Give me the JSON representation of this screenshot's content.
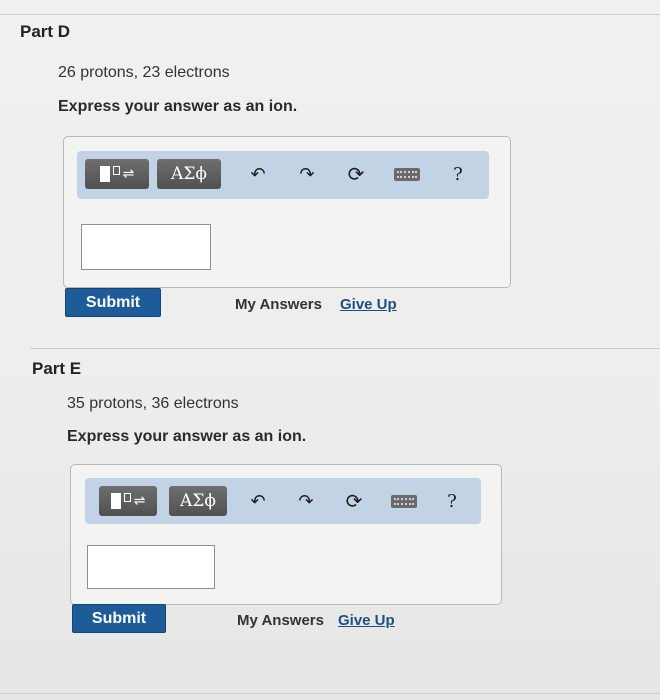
{
  "parts": [
    {
      "title": "Part D",
      "question": "26 protons, 23 electrons",
      "prompt": "Express your answer as an ion.",
      "toolbar": {
        "symbols_label": "ΑΣϕ",
        "help_label": "?"
      },
      "answer_value": "",
      "submit_label": "Submit",
      "my_answers_label": "My Answers",
      "give_up_label": "Give Up"
    },
    {
      "title": "Part E",
      "question": "35 protons, 36 electrons",
      "prompt": "Express your answer as an ion.",
      "toolbar": {
        "symbols_label": "ΑΣϕ",
        "help_label": "?"
      },
      "answer_value": "",
      "submit_label": "Submit",
      "my_answers_label": "My Answers",
      "give_up_label": "Give Up"
    }
  ],
  "icons": [
    "matrix-template-icon",
    "undo-icon",
    "redo-icon",
    "reset-icon",
    "keyboard-icon"
  ],
  "colors": {
    "submit_bg": "#1d5c99",
    "toolbar_bg": "#c3d3e6",
    "link": "#1d4f87"
  }
}
